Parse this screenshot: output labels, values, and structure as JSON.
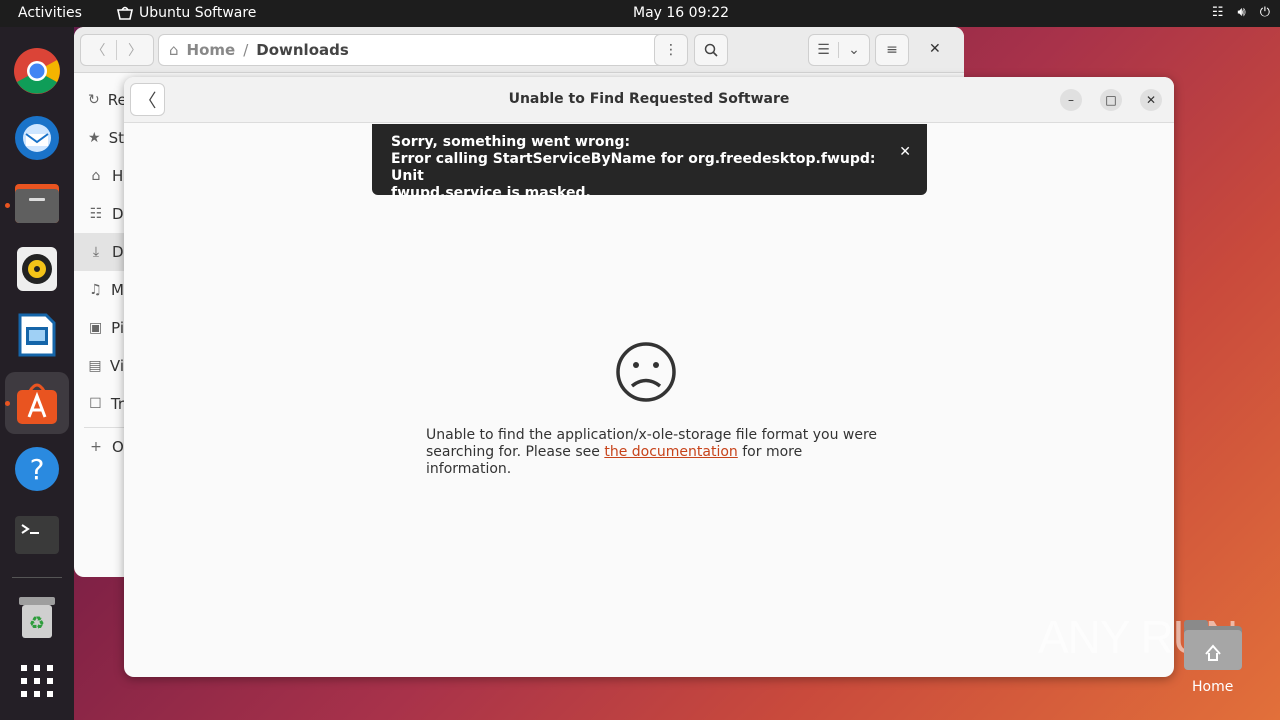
{
  "topbar": {
    "activities": "Activities",
    "app_name": "Ubuntu Software",
    "clock": "May 16  09:22"
  },
  "dock": {
    "items": [
      "Google Chrome",
      "Thunderbird",
      "Files",
      "Rhythmbox",
      "LibreOffice Writer",
      "Ubuntu Software",
      "Help",
      "Terminal",
      "Trash",
      "Show Applications"
    ]
  },
  "files_window": {
    "path_home": "Home",
    "path_separator": "/",
    "path_current": "Downloads",
    "sidebar": [
      {
        "label": "Re",
        "icon": "recent-icon"
      },
      {
        "label": "St",
        "icon": "star-icon"
      },
      {
        "label": "H",
        "icon": "home-icon"
      },
      {
        "label": "D",
        "icon": "document-icon"
      },
      {
        "label": "D",
        "icon": "download-icon"
      },
      {
        "label": "M",
        "icon": "music-icon"
      },
      {
        "label": "Pi",
        "icon": "picture-icon"
      },
      {
        "label": "Vi",
        "icon": "video-icon"
      },
      {
        "label": "Tr",
        "icon": "trash-icon"
      },
      {
        "label": "O",
        "icon": "plus-icon"
      }
    ]
  },
  "dialog": {
    "title": "Unable to Find Requested Software",
    "toast_line1": "Sorry, something went wrong:",
    "toast_line2": "Error calling StartServiceByName for org.freedesktop.fwupd: Unit",
    "toast_line3": "fwupd.service is masked.",
    "message_part1": "Unable to find the application/x-ole-storage file format you were searching for. Please see",
    "message_link": "the documentation",
    "message_part2": "for more information."
  },
  "desktop": {
    "home_label": "Home",
    "watermark": "ANY RUN"
  }
}
